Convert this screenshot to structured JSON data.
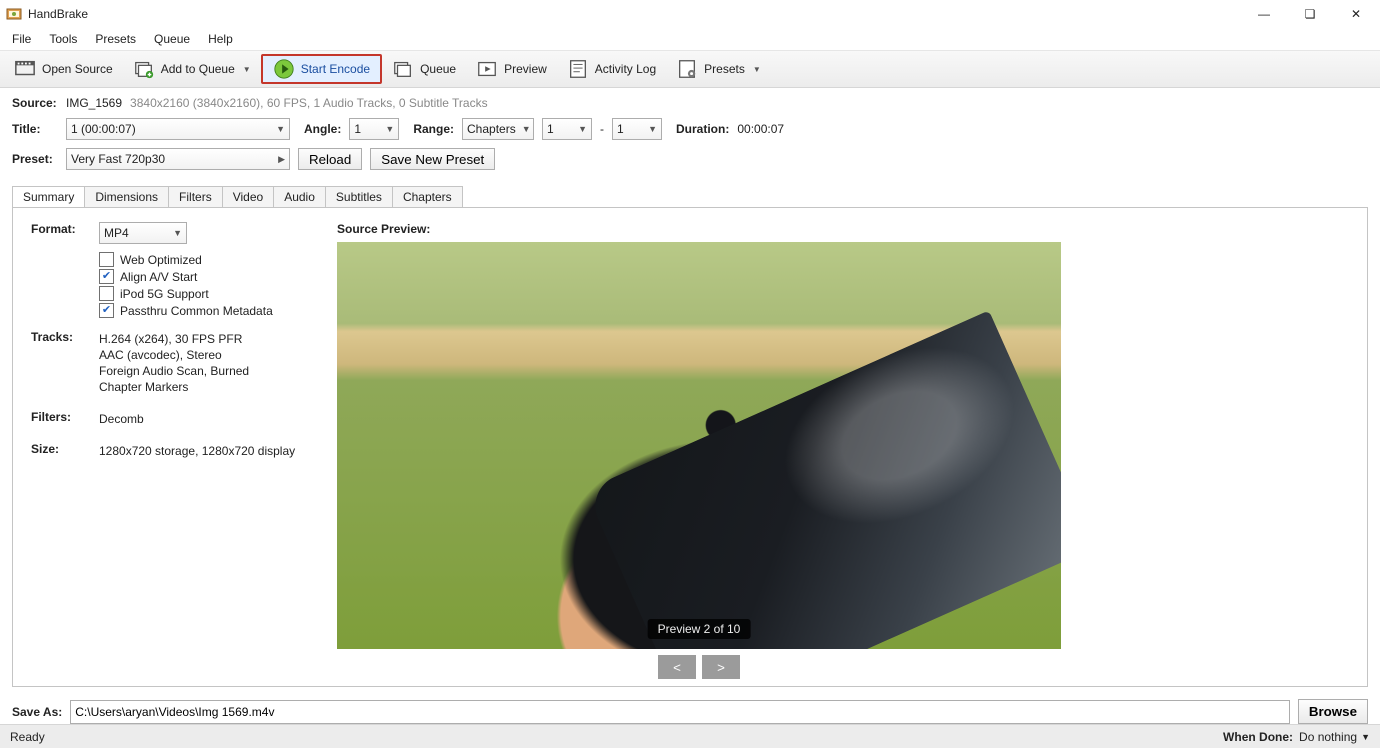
{
  "app": {
    "title": "HandBrake"
  },
  "menu": {
    "items": [
      "File",
      "Tools",
      "Presets",
      "Queue",
      "Help"
    ]
  },
  "toolbar": {
    "open_source": "Open Source",
    "add_to_queue": "Add to Queue",
    "start_encode": "Start Encode",
    "queue": "Queue",
    "preview": "Preview",
    "activity_log": "Activity Log",
    "presets": "Presets"
  },
  "source": {
    "label": "Source:",
    "name": "IMG_1569",
    "details": "3840x2160 (3840x2160), 60 FPS, 1 Audio Tracks, 0 Subtitle Tracks"
  },
  "title_row": {
    "title_label": "Title:",
    "title_value": "1  (00:00:07)",
    "angle_label": "Angle:",
    "angle_value": "1",
    "range_label": "Range:",
    "range_type": "Chapters",
    "range_from": "1",
    "range_sep": "-",
    "range_to": "1",
    "duration_label": "Duration:",
    "duration_value": "00:00:07"
  },
  "preset_row": {
    "label": "Preset:",
    "value": "Very Fast 720p30",
    "reload": "Reload",
    "save_new": "Save New Preset"
  },
  "tabs": [
    "Summary",
    "Dimensions",
    "Filters",
    "Video",
    "Audio",
    "Subtitles",
    "Chapters"
  ],
  "summary": {
    "format_label": "Format:",
    "format_value": "MP4",
    "checks": {
      "web_optimized": {
        "label": "Web Optimized",
        "checked": false
      },
      "align_av": {
        "label": "Align A/V Start",
        "checked": true
      },
      "ipod": {
        "label": "iPod 5G Support",
        "checked": false
      },
      "passthru": {
        "label": "Passthru Common Metadata",
        "checked": true
      }
    },
    "tracks_label": "Tracks:",
    "tracks": [
      "H.264 (x264), 30 FPS PFR",
      "AAC (avcodec), Stereo",
      "Foreign Audio Scan, Burned",
      "Chapter Markers"
    ],
    "filters_label": "Filters:",
    "filters_value": "Decomb",
    "size_label": "Size:",
    "size_value": "1280x720 storage, 1280x720 display",
    "preview_title": "Source Preview:",
    "preview_caption": "Preview 2 of 10",
    "prev_symbol": "<",
    "next_symbol": ">"
  },
  "save_as": {
    "label": "Save As:",
    "path": "C:\\Users\\aryan\\Videos\\Img 1569.m4v",
    "browse": "Browse"
  },
  "status": {
    "ready": "Ready",
    "when_done_label": "When Done:",
    "when_done_value": "Do nothing"
  }
}
